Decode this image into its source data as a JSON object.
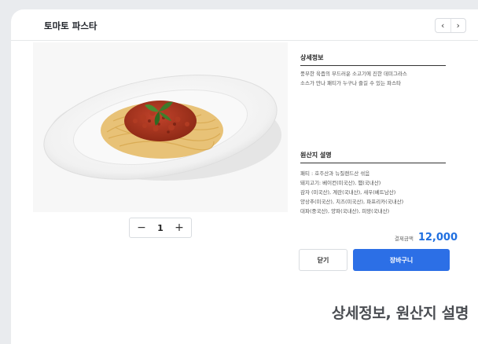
{
  "header": {
    "title": "토마토 파스타",
    "prev_label": "‹",
    "next_label": "›"
  },
  "product": {
    "image_icon": "pasta-dish-image",
    "quantity": "1",
    "minus_label": "−",
    "plus_label": "+"
  },
  "detail": {
    "title": "상세정보",
    "lines": [
      "풍부한 육즙의 부드러운 소고기에 진한 데미그라스",
      "소스가 만나 패티가 누구나 즐길 수 있는 파스타"
    ]
  },
  "origin": {
    "title": "원산지 설명",
    "lines": [
      "패티 : 호주산과 뉴질랜드산 섞음",
      "돼지고기: 베이컨(미국산), 햄(국내산)",
      "감자 (미국산), 계란(국내산), 새우(베트남산)",
      "양상추(미국산), 치즈(미국산), 파프리카(국내산)",
      "대파(중국산), 양파(국내산), 피망(국내산)"
    ]
  },
  "payment": {
    "label": "결제금액",
    "amount": "12,000"
  },
  "actions": {
    "close_label": "닫기",
    "cart_label": "장바구니"
  },
  "caption": "상세정보, 원산지 설명",
  "colors": {
    "accent": "#2c6fe6",
    "price": "#1f6fe0"
  }
}
